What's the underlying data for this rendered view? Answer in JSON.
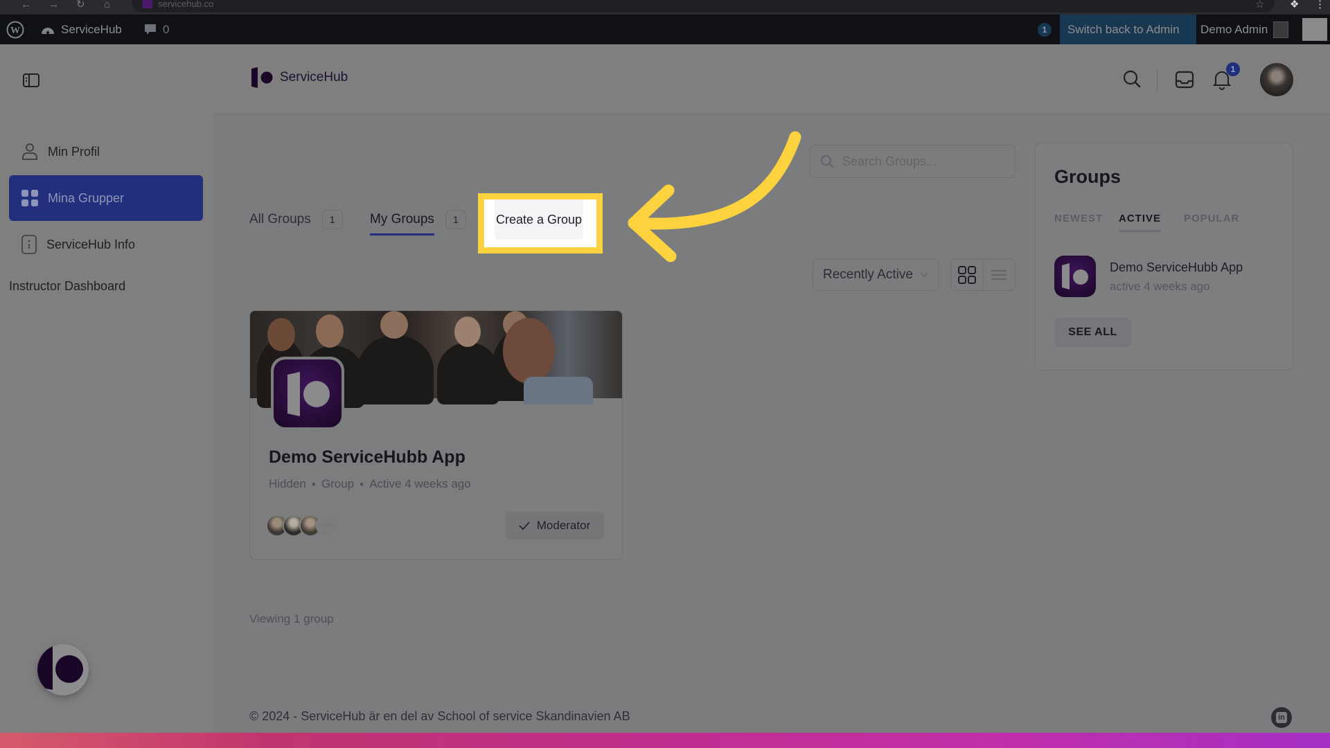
{
  "browser": {
    "url": "servicehub.co"
  },
  "admin_bar": {
    "site_name": "ServiceHub",
    "comments_count": "0",
    "notification_count": "1",
    "switch_back": "Switch back to Admin",
    "user_name": "Demo Admin"
  },
  "sidebar": {
    "items": [
      {
        "label": "Min Profil",
        "icon": "user-icon"
      },
      {
        "label": "Mina Grupper",
        "icon": "grid-icon",
        "active": true
      },
      {
        "label": "ServiceHub Info",
        "icon": "info-icon"
      }
    ],
    "extra_link": "Instructor Dashboard"
  },
  "header": {
    "brand": "ServiceHub",
    "notification_badge": "1"
  },
  "groups_page": {
    "tabs": [
      {
        "label": "All Groups",
        "count": "1"
      },
      {
        "label": "My Groups",
        "count": "1",
        "active": true
      }
    ],
    "create_button": "Create a Group",
    "search_placeholder": "Search Groups...",
    "sort_selected": "Recently Active",
    "view_modes": [
      "grid",
      "list"
    ],
    "viewing_text": "Viewing 1 group"
  },
  "group_card": {
    "name": "Demo ServiceHubb App",
    "meta": [
      "Hidden",
      "Group",
      "Active 4 weeks ago"
    ],
    "more_members": "···",
    "role_label": "Moderator"
  },
  "widget": {
    "title": "Groups",
    "tabs": [
      "NEWEST",
      "ACTIVE",
      "POPULAR"
    ],
    "active_tab": "ACTIVE",
    "item": {
      "name": "Demo ServiceHubb App",
      "activity": "active 4 weeks ago"
    },
    "see_all": "SEE ALL"
  },
  "footer": {
    "copyright": "© 2024 - ServiceHub är en del av School of service Skandinavien AB"
  },
  "colors": {
    "highlight": "#fdd23f",
    "accent": "#222f7c",
    "brand_purple": "#1a0626"
  }
}
